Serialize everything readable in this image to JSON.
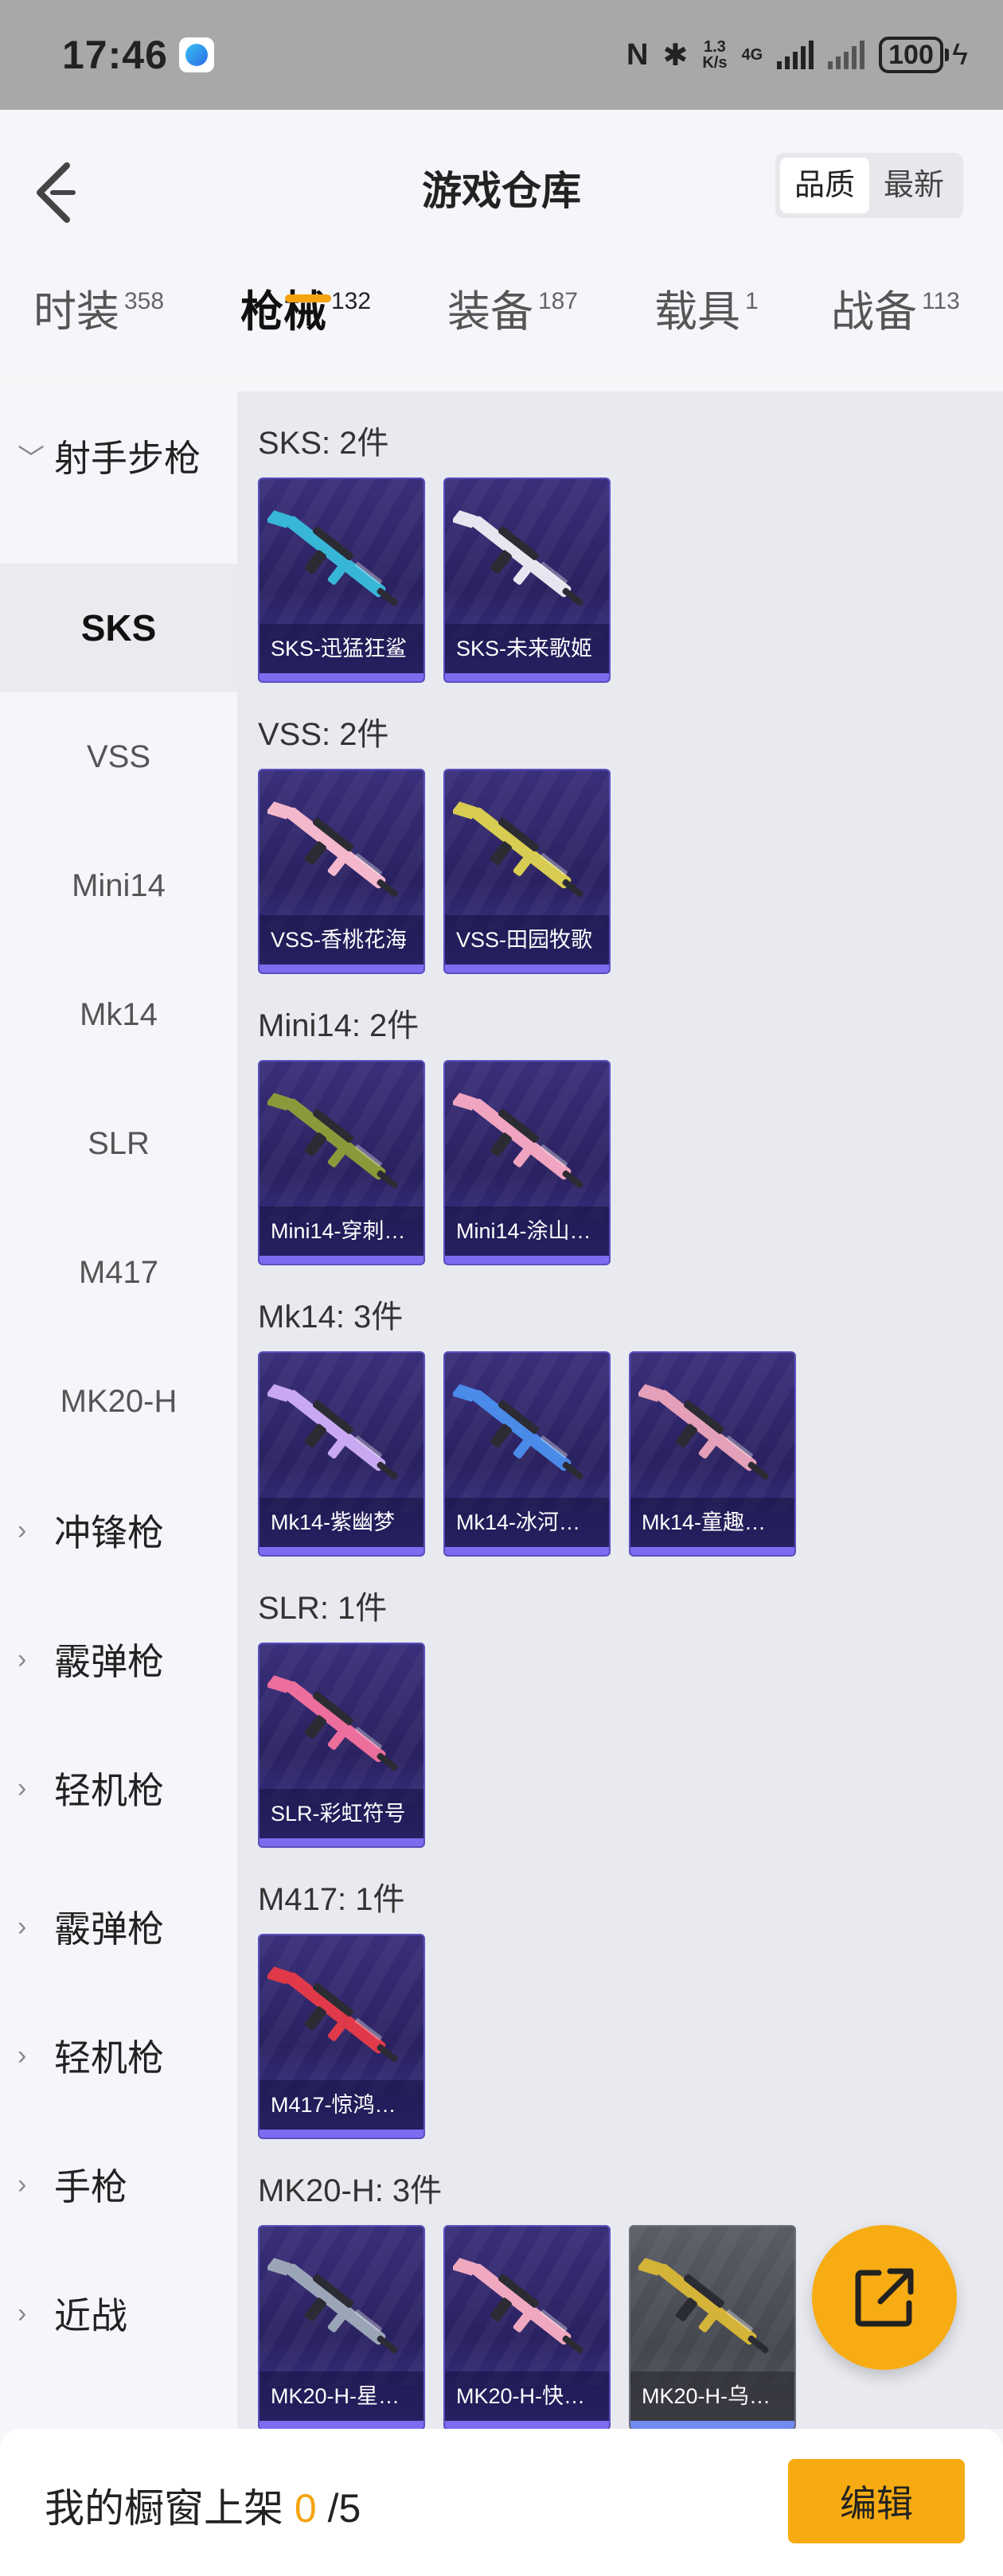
{
  "status_bar": {
    "time": "17:46",
    "nfc": "N",
    "bluetooth": "✱",
    "speed_value": "1.3",
    "speed_unit": "K/s",
    "network": "4G",
    "battery": "100"
  },
  "header": {
    "title": "游戏仓库",
    "sort_options": [
      "品质",
      "最新"
    ],
    "sort_active": "品质"
  },
  "tabs": [
    {
      "label": "时装",
      "count": "358"
    },
    {
      "label": "枪械",
      "count": "132"
    },
    {
      "label": "装备",
      "count": "187"
    },
    {
      "label": "载具",
      "count": "1"
    },
    {
      "label": "战备",
      "count": "113"
    }
  ],
  "active_tab": "枪械",
  "sidebar": {
    "expanded_category": "射手步枪",
    "selected": "SKS",
    "sub_items": [
      "SKS",
      "VSS",
      "Mini14",
      "Mk14",
      "SLR",
      "M417",
      "MK20-H"
    ],
    "collapsed_categories": [
      "冲锋枪",
      "霰弹枪",
      "轻机枪",
      "霰弹枪",
      "轻机枪",
      "手枪",
      "近战"
    ]
  },
  "groups": [
    {
      "title": "SKS: 2件",
      "items": [
        {
          "name": "SKS-迅猛狂鲨",
          "accent": "#38b6d8"
        },
        {
          "name": "SKS-未来歌姬",
          "accent": "#e8e4f0"
        }
      ]
    },
    {
      "title": "VSS: 2件",
      "items": [
        {
          "name": "VSS-香桃花海",
          "accent": "#f4b8cc"
        },
        {
          "name": "VSS-田园牧歌",
          "accent": "#d8cc52"
        }
      ]
    },
    {
      "title": "Mini14: 2件",
      "items": [
        {
          "name": "Mini14-穿刺…",
          "accent": "#8a9a3a"
        },
        {
          "name": "Mini14-涂山…",
          "accent": "#f0a4c0"
        }
      ]
    },
    {
      "title": "Mk14: 3件",
      "items": [
        {
          "name": "Mk14-紫幽梦",
          "accent": "#c8a8f0"
        },
        {
          "name": "Mk14-冰河…",
          "accent": "#4a8ae8"
        },
        {
          "name": "Mk14-童趣…",
          "accent": "#e4a0b8"
        }
      ]
    },
    {
      "title": "SLR: 1件",
      "items": [
        {
          "name": "SLR-彩虹符号",
          "accent": "#ec6e9c"
        }
      ]
    },
    {
      "title": "M417: 1件",
      "items": [
        {
          "name": "M417-惊鸿…",
          "accent": "#e03a4a"
        }
      ]
    },
    {
      "title": "MK20-H: 3件",
      "items": [
        {
          "name": "MK20-H-星…",
          "accent": "#9aa6b8"
        },
        {
          "name": "MK20-H-快…",
          "accent": "#f0a8c0"
        },
        {
          "name": "MK20-H-乌…",
          "accent": "#d4b438",
          "gray": true
        }
      ]
    }
  ],
  "bottom": {
    "label": "我的橱窗上架",
    "current": "0",
    "total": "/5",
    "edit": "编辑"
  }
}
